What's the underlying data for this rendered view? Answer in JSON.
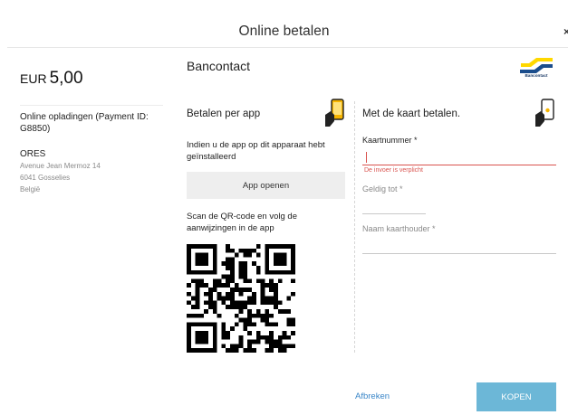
{
  "header": {
    "title": "Online betalen",
    "close_glyph": "×"
  },
  "summary": {
    "currency": "EUR",
    "amount": "5,00",
    "description": "Online opladingen (Payment ID: G8850)",
    "merchant": {
      "name": "ORES",
      "address_lines": [
        "Avenue Jean Mermoz 14",
        "6041 Gosselies",
        "België"
      ]
    }
  },
  "method": {
    "name": "Bancontact",
    "logo_text": "Bancontact"
  },
  "app_section": {
    "heading": "Betalen per app",
    "hint": "Indien u de app op dit apparaat hebt geïnstalleerd",
    "open_button": "App openen",
    "qr_hint": "Scan de QR-code en volg de aanwijzingen in de app"
  },
  "card_section": {
    "heading": "Met de kaart betalen.",
    "card_number_label": "Kaartnummer *",
    "card_number_error": "De invoer is verplicht",
    "expiry_label": "Geldig tot *",
    "holder_label": "Naam kaarthouder *"
  },
  "footer": {
    "cancel": "Afbreken",
    "buy": "KOPEN"
  },
  "colors": {
    "error": "#d9534f",
    "link": "#3a86c8",
    "primary_button": "#6cb7d7",
    "bancontact_blue": "#1b4d8c",
    "bancontact_yellow": "#ffd800",
    "phone_orange": "#f6b400"
  },
  "icons": [
    "close-icon",
    "bancontact-logo",
    "phone-hand-icon",
    "qr-code"
  ]
}
